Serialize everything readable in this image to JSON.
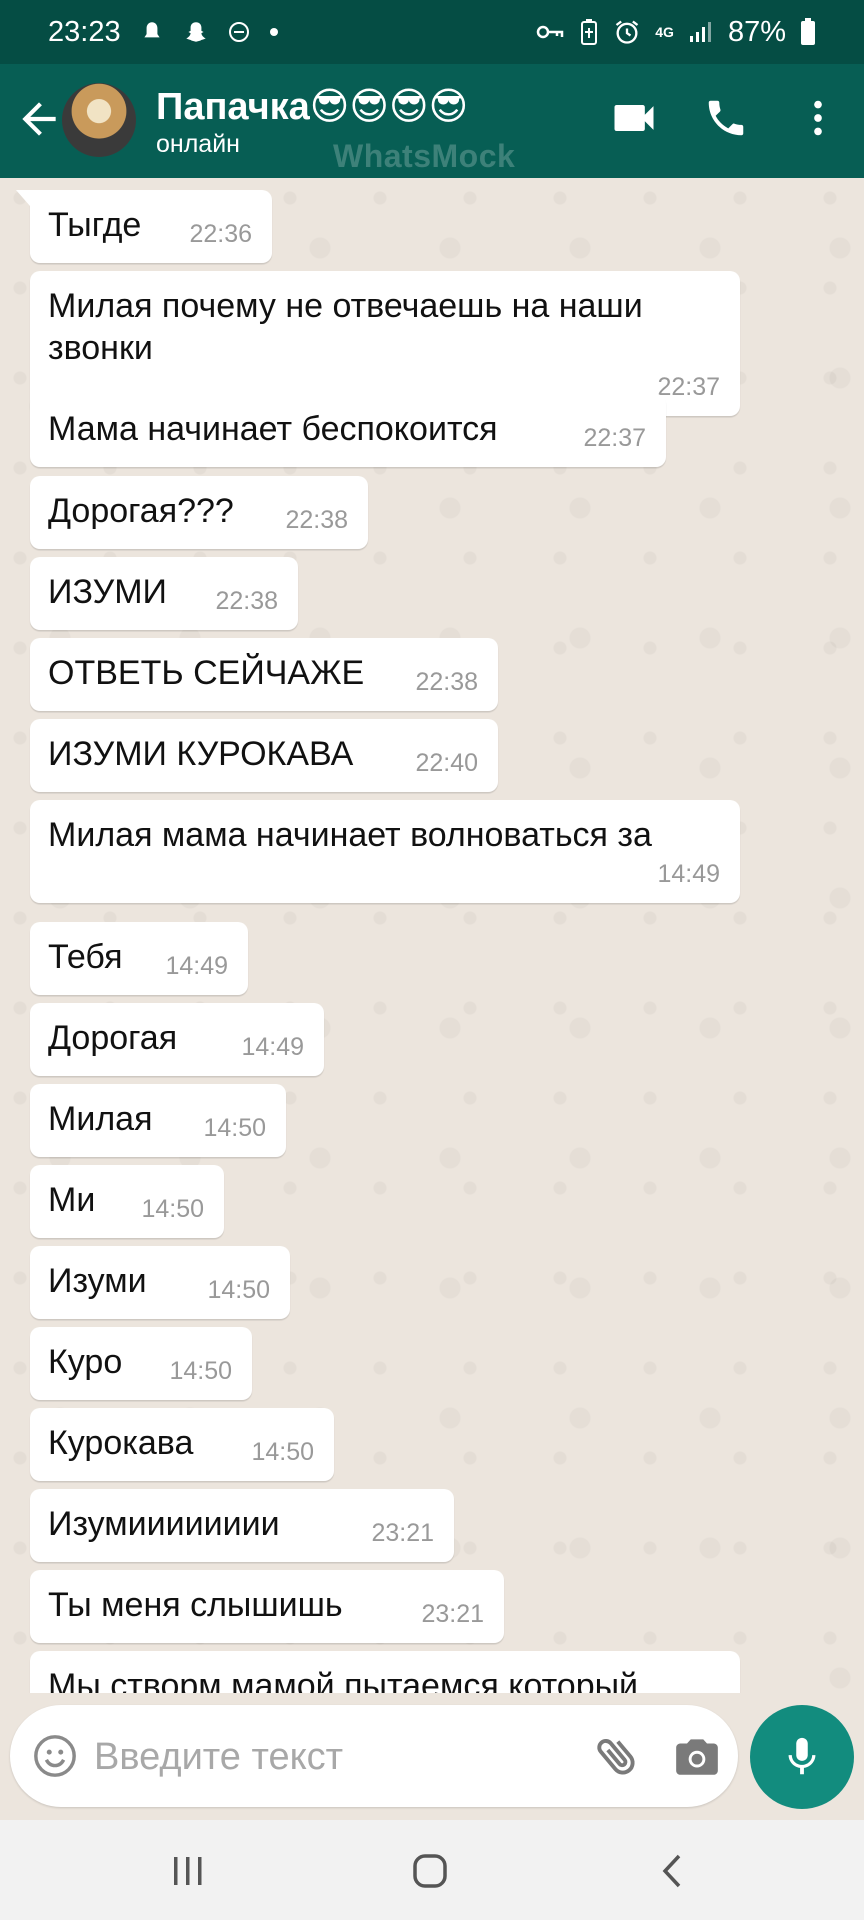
{
  "status_bar": {
    "time": "23:23",
    "battery": "87%",
    "network": "4G"
  },
  "header": {
    "contact_name": "Папачка😎😎😎😎",
    "status": "онлайн",
    "watermark": "WhatsMock"
  },
  "messages": [
    {
      "text": "Тыгде",
      "time": "22:36"
    },
    {
      "text": "Милая почему не отвечаешь на наши звонки",
      "time": "22:37"
    },
    {
      "text": "Мама начинает беспокоится",
      "time": "22:37"
    },
    {
      "text": "Дорогая???",
      "time": "22:38"
    },
    {
      "text": "ИЗУМИ",
      "time": "22:38"
    },
    {
      "text": "ОТВЕТЬ СЕЙЧАЖЕ",
      "time": "22:38"
    },
    {
      "text": "ИЗУМИ КУРОКАВА",
      "time": "22:40"
    },
    {
      "text": "Милая мама начинает волноваться за",
      "time": "14:49"
    },
    {
      "text": "Тебя",
      "time": "14:49"
    },
    {
      "text": "Дорогая",
      "time": "14:49"
    },
    {
      "text": "Милая",
      "time": "14:50"
    },
    {
      "text": "Ми",
      "time": "14:50"
    },
    {
      "text": "Изуми",
      "time": "14:50"
    },
    {
      "text": "Куро",
      "time": "14:50"
    },
    {
      "text": "Курокава",
      "time": "14:50"
    },
    {
      "text": "Изумииииииии",
      "time": "23:21"
    },
    {
      "text": "Ты меня слышишь",
      "time": "23:21"
    },
    {
      "text": "Мы створм мамой пытаемся который",
      "time": ""
    }
  ],
  "input": {
    "placeholder": "Введите текст",
    "value": ""
  },
  "colors": {
    "status_bar": "#054d44",
    "header": "#075e54",
    "chat_bg": "#ece5dd",
    "bubble": "#ffffff",
    "mic_button": "#128c7e"
  },
  "icons": [
    "back-arrow-icon",
    "video-call-icon",
    "phone-icon",
    "more-vert-icon",
    "emoji-icon",
    "attach-icon",
    "camera-icon",
    "mic-icon",
    "recents-icon",
    "home-icon",
    "nav-back-icon"
  ]
}
